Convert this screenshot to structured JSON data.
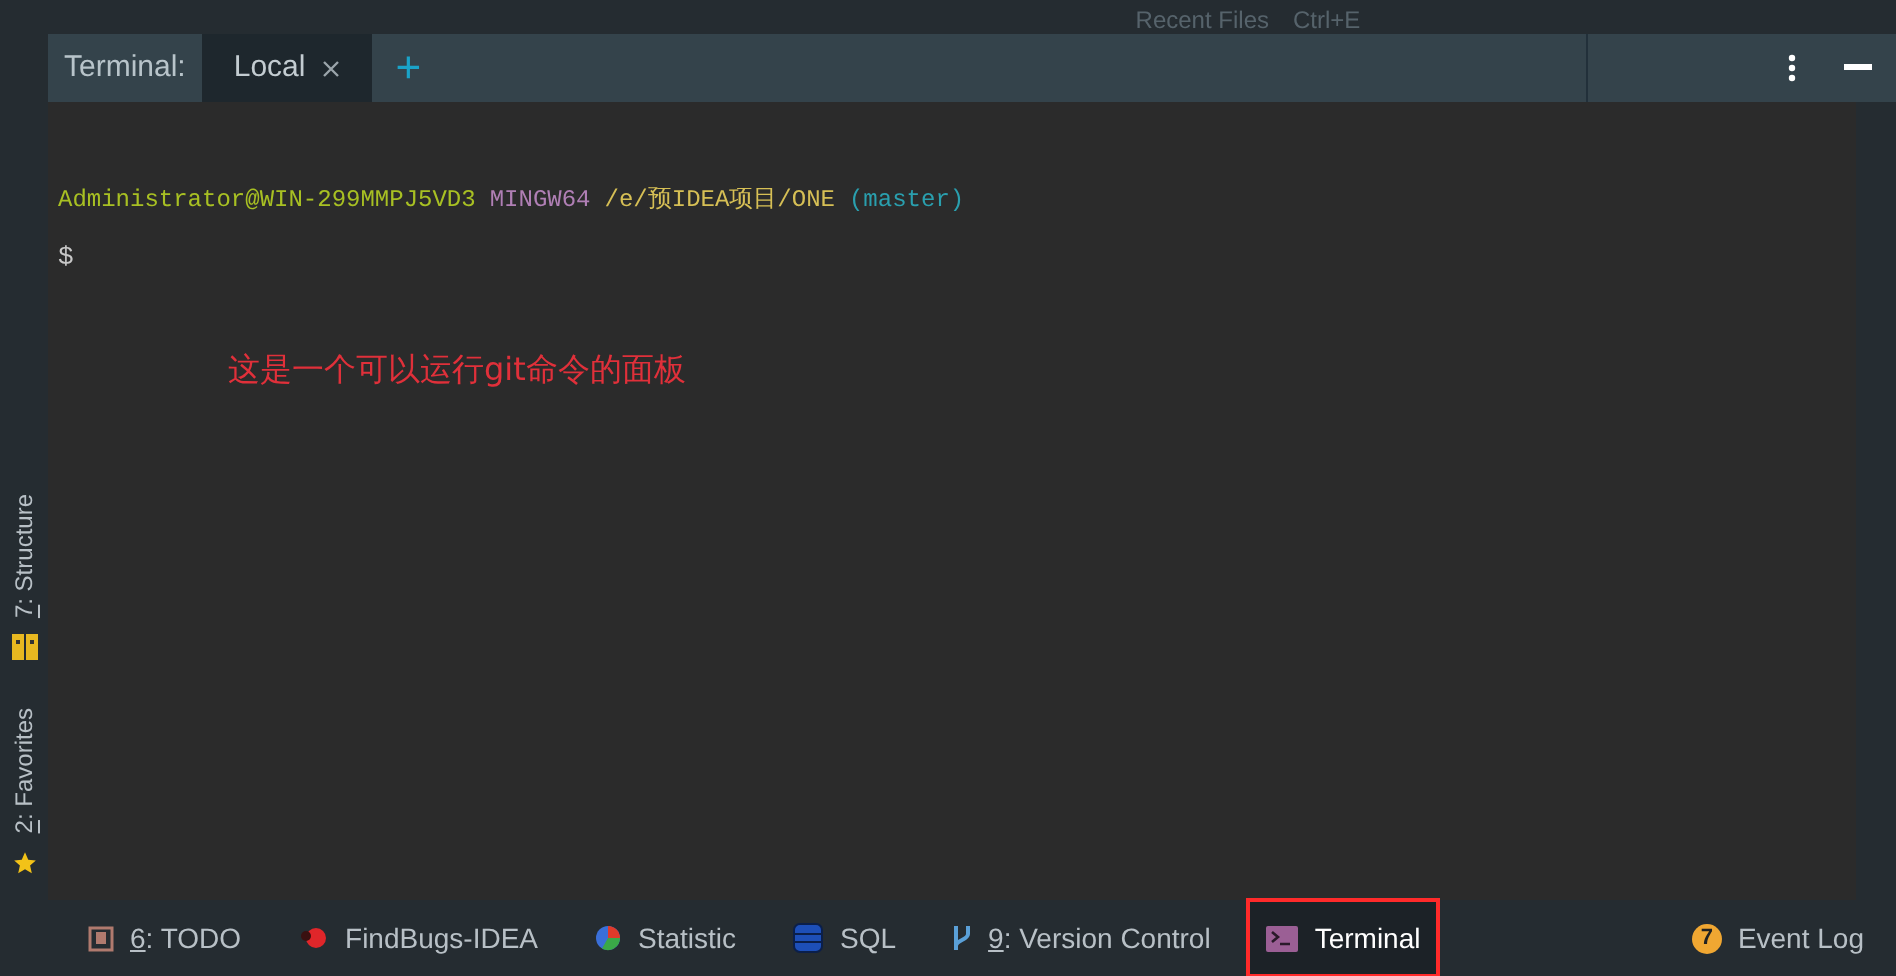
{
  "top_strip": {
    "title": "Recent Files",
    "shortcut": "Ctrl+E"
  },
  "side_tabs": [
    {
      "key": "2",
      "label": ": Favorites",
      "kind": "star"
    },
    {
      "key": "7",
      "label": ": Structure",
      "kind": "structure"
    }
  ],
  "tool_window": {
    "title": "Terminal:",
    "tabs": [
      {
        "label": "Local",
        "selected": true
      }
    ],
    "add": "+"
  },
  "terminal": {
    "prompt_line": [
      {
        "text": "Administrator@WIN-299MMPJ5VD3",
        "color": "#a8c023"
      },
      {
        "text": "MINGW64",
        "color": "#b07fb5"
      },
      {
        "text": "/e/预IDEA项目/ONE",
        "color": "#d6bf55"
      },
      {
        "text": "(master)",
        "color": "#2a9fae"
      }
    ],
    "cursor_line": "$",
    "annotation": "这是一个可以运行git命令的面板"
  },
  "bottom_tabs": [
    {
      "key": "6",
      "label": ": TODO",
      "kind": "todo",
      "selected": false,
      "annotated": false
    },
    {
      "label": "FindBugs-IDEA",
      "kind": "bug",
      "selected": false,
      "annotated": false
    },
    {
      "label": "Statistic",
      "kind": "pie",
      "selected": false,
      "annotated": false
    },
    {
      "label": "SQL",
      "kind": "database",
      "selected": false,
      "annotated": false
    },
    {
      "key": "9",
      "label": ": Version Control",
      "kind": "branch",
      "selected": false,
      "annotated": false
    },
    {
      "label": "Terminal",
      "kind": "terminal",
      "selected": true,
      "annotated": true
    }
  ],
  "event_log": {
    "badge": "7",
    "label": "Event Log"
  }
}
